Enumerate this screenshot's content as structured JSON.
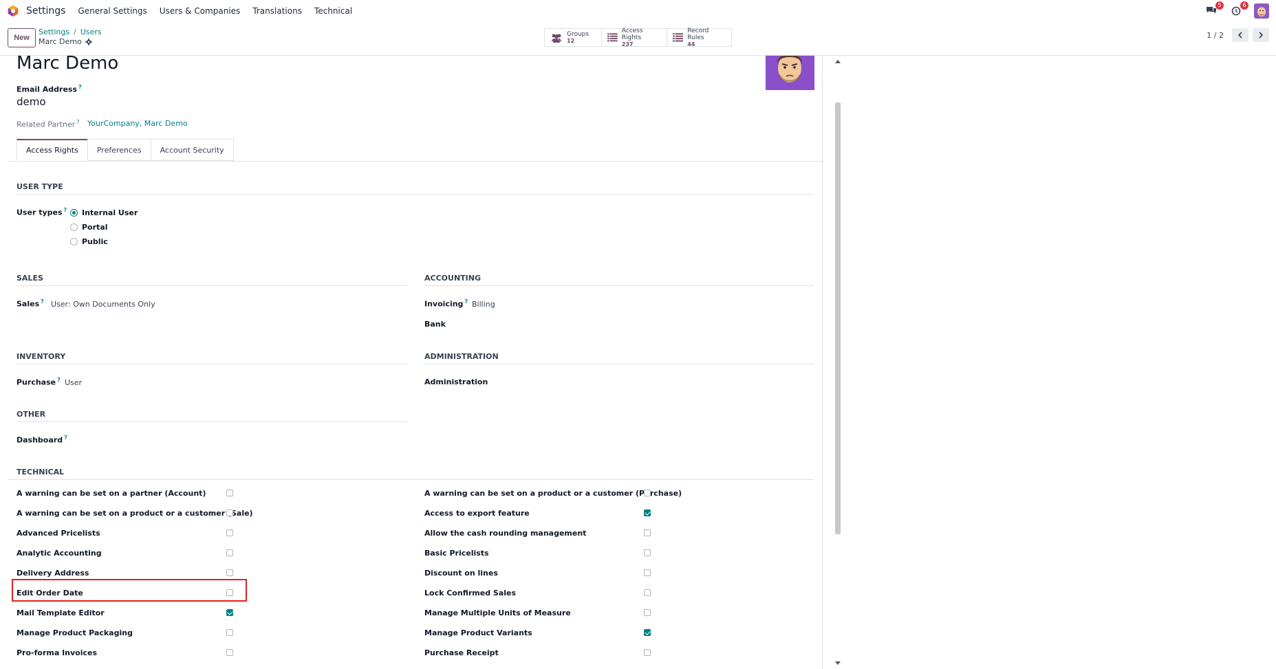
{
  "navbar": {
    "app_name": "Settings",
    "menu": [
      "General Settings",
      "Users & Companies",
      "Translations",
      "Technical"
    ],
    "messages_badge": "5",
    "activities_badge": "6"
  },
  "control_panel": {
    "new_label": "New",
    "breadcrumb": [
      "Settings",
      "Users"
    ],
    "record_name": "Marc Demo",
    "smart_buttons": [
      {
        "label": "Groups",
        "count": "12",
        "icon": "users-icon"
      },
      {
        "label": "Access Rights",
        "count": "237",
        "icon": "list-icon"
      },
      {
        "label": "Record Rules",
        "count": "44",
        "icon": "list-icon"
      }
    ],
    "pager": "1 / 2"
  },
  "form": {
    "name": "Marc Demo",
    "email_label": "Email Address",
    "email_value": "demo",
    "related_partner_label": "Related Partner",
    "related_partner_value": "YourCompany, Marc Demo",
    "tabs": [
      "Access Rights",
      "Preferences",
      "Account Security"
    ],
    "user_type": {
      "section": "USER TYPE",
      "label": "User types",
      "options": [
        "Internal User",
        "Portal",
        "Public"
      ],
      "selected": "Internal User"
    },
    "sales": {
      "section": "SALES",
      "label": "Sales",
      "value": "User: Own Documents Only"
    },
    "accounting": {
      "section": "ACCOUNTING",
      "invoicing_label": "Invoicing",
      "invoicing_value": "Billing",
      "bank_label": "Bank"
    },
    "inventory": {
      "section": "INVENTORY",
      "label": "Purchase",
      "value": "User"
    },
    "administration": {
      "section": "ADMINISTRATION",
      "label": "Administration"
    },
    "other": {
      "section": "OTHER",
      "label": "Dashboard"
    },
    "technical": {
      "section": "TECHNICAL",
      "left": [
        {
          "label": "A warning can be set on a partner (Account)",
          "checked": false
        },
        {
          "label": "A warning can be set on a product or a customer (Sale)",
          "checked": false
        },
        {
          "label": "Advanced Pricelists",
          "checked": false
        },
        {
          "label": "Analytic Accounting",
          "checked": false
        },
        {
          "label": "Delivery Address",
          "checked": false
        },
        {
          "label": "Edit Order Date",
          "checked": false
        },
        {
          "label": "Mail Template Editor",
          "checked": true
        },
        {
          "label": "Manage Product Packaging",
          "checked": false
        },
        {
          "label": "Pro-forma Invoices",
          "checked": false
        }
      ],
      "right": [
        {
          "label": "A warning can be set on a product or a customer (Purchase)",
          "checked": false
        },
        {
          "label": "Access to export feature",
          "checked": true
        },
        {
          "label": "Allow the cash rounding management",
          "checked": false
        },
        {
          "label": "Basic Pricelists",
          "checked": false
        },
        {
          "label": "Discount on lines",
          "checked": false
        },
        {
          "label": "Lock Confirmed Sales",
          "checked": false
        },
        {
          "label": "Manage Multiple Units of Measure",
          "checked": false
        },
        {
          "label": "Manage Product Variants",
          "checked": true
        },
        {
          "label": "Purchase Receipt",
          "checked": false
        }
      ]
    }
  },
  "colors": {
    "brand": "#714b67",
    "accent": "#017e84",
    "highlight": "#e01f1f"
  }
}
